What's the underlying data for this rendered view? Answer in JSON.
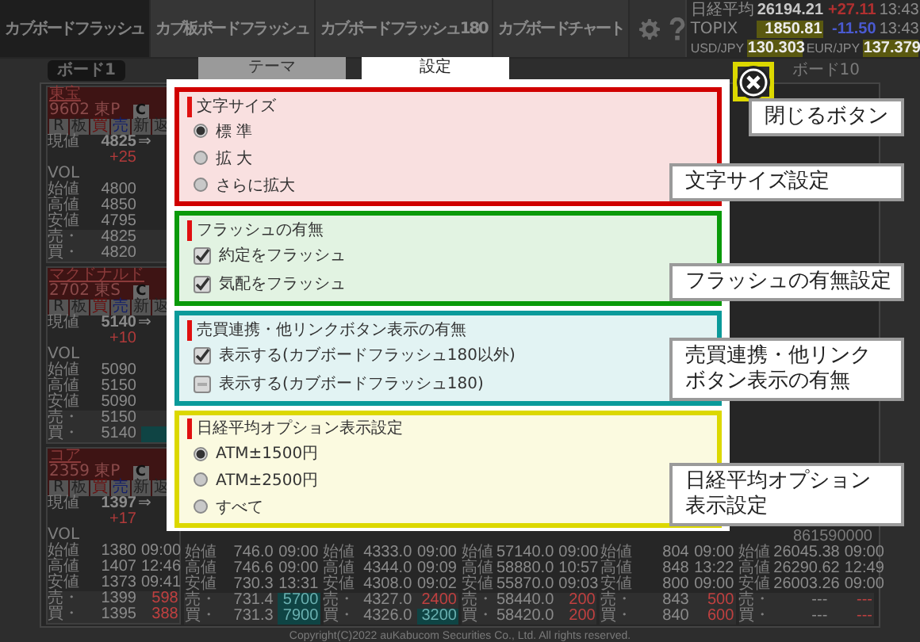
{
  "nav": {
    "tabs": [
      {
        "label": "カブボードフラッシュ",
        "selected": true
      },
      {
        "label": "カブ板ボードフラッシュ",
        "selected": false
      },
      {
        "label": "カブボードフラッシュ180",
        "selected": false
      },
      {
        "label": "カブボードチャート",
        "selected": false
      }
    ]
  },
  "indices": [
    {
      "name": "日経平均",
      "value": "26194.21",
      "highlight": false,
      "change": "+27.11",
      "color": "#b03030",
      "time": "13:43"
    },
    {
      "name": "TOPIX",
      "value": "1850.81",
      "highlight": true,
      "change": "-11.50",
      "color": "#4a5ad0",
      "time": "13:43"
    }
  ],
  "fx": [
    {
      "name": "USD/JPY",
      "value": "130.303",
      "highlight": true
    },
    {
      "name": "EUR/JPY",
      "value": "137.379",
      "highlight": true
    }
  ],
  "board_tabs": [
    {
      "label": "ボード1",
      "selected": true
    },
    {
      "label": "ボード10",
      "selected": false
    }
  ],
  "columns": [
    {
      "cards": [
        {
          "name": "東宝",
          "code": "9602 東P",
          "chip": "C",
          "buttons": [
            {
              "label": "R",
              "kind": "plain"
            },
            {
              "label": "板",
              "kind": "plain"
            },
            {
              "label": "買",
              "kind": "buy"
            },
            {
              "label": "売",
              "kind": "sell"
            },
            {
              "label": "新",
              "kind": "plain"
            },
            {
              "label": "返",
              "kind": "plain"
            }
          ],
          "price_label": "現値",
          "price": "4825",
          "arrow": "⇒",
          "change": "+25",
          "vol_label": "VOL",
          "rows": [
            {
              "label": "始値",
              "price": "4800",
              "kind": "time"
            },
            {
              "label": "高値",
              "price": "4850",
              "kind": "time"
            },
            {
              "label": "安値",
              "price": "4795",
              "kind": "time"
            },
            {
              "label": "売・",
              "price": "4825",
              "kind": "qty",
              "highlight": false
            },
            {
              "label": "買・",
              "price": "4820",
              "kind": "qty",
              "highlight": false
            }
          ]
        },
        {
          "name": "マクドナルド",
          "code": "2702 東S",
          "chip": "C",
          "buttons": [
            {
              "label": "R",
              "kind": "plain"
            },
            {
              "label": "板",
              "kind": "plain"
            },
            {
              "label": "買",
              "kind": "buy"
            },
            {
              "label": "売",
              "kind": "sell"
            },
            {
              "label": "新",
              "kind": "plain"
            },
            {
              "label": "返",
              "kind": "plain"
            }
          ],
          "price_label": "現値",
          "price": "5140",
          "arrow": "⇒",
          "change": "+10",
          "vol_label": "VOL",
          "rows": [
            {
              "label": "始値",
              "price": "5090",
              "kind": "time"
            },
            {
              "label": "高値",
              "price": "5150",
              "kind": "time"
            },
            {
              "label": "安値",
              "price": "5090",
              "kind": "time"
            },
            {
              "label": "売・",
              "price": "5150",
              "kind": "qty",
              "highlight": false
            },
            {
              "label": "買・",
              "price": "5140",
              "kind": "qty",
              "highlight": true
            }
          ]
        },
        {
          "name": "コア",
          "code": "2359 東P",
          "chip": "C",
          "buttons": [
            {
              "label": "R",
              "kind": "plain"
            },
            {
              "label": "板",
              "kind": "plain"
            },
            {
              "label": "買",
              "kind": "buy"
            },
            {
              "label": "売",
              "kind": "sell"
            },
            {
              "label": "新",
              "kind": "plain"
            },
            {
              "label": "返",
              "kind": "plain"
            }
          ],
          "price_label": "現値",
          "price": "1397",
          "arrow": "⇒",
          "change": "+17",
          "vol_label": "VOL",
          "rows": [
            {
              "label": "始値",
              "price": "1380",
              "extra": "09:00",
              "kind": "time"
            },
            {
              "label": "高値",
              "price": "1407",
              "extra": "12:46",
              "kind": "time"
            },
            {
              "label": "安値",
              "price": "1373",
              "extra": "09:41",
              "kind": "time"
            },
            {
              "label": "売・",
              "price": "1399",
              "extra": "598",
              "kind": "qty",
              "highlight": false
            },
            {
              "label": "買・",
              "price": "1395",
              "extra": "388",
              "kind": "qty",
              "highlight": false
            }
          ]
        }
      ]
    },
    {
      "tail": {
        "rows": [
          {
            "label": "始値",
            "price": "746.0",
            "extra": "09:00",
            "kind": "time"
          },
          {
            "label": "高値",
            "price": "746.6",
            "extra": "09:00",
            "kind": "time"
          },
          {
            "label": "安値",
            "price": "730.3",
            "extra": "13:31",
            "kind": "time"
          },
          {
            "label": "売・",
            "price": "731.4",
            "extra": "5700",
            "kind": "qty",
            "highlight": true
          },
          {
            "label": "買・",
            "price": "731.3",
            "extra": "7900",
            "kind": "qty",
            "highlight": true
          }
        ]
      }
    },
    {
      "tail": {
        "rows": [
          {
            "label": "始値",
            "price": "4333.0",
            "extra": "09:00",
            "kind": "time"
          },
          {
            "label": "高値",
            "price": "4344.0",
            "extra": "09:09",
            "kind": "time"
          },
          {
            "label": "安値",
            "price": "4308.0",
            "extra": "09:02",
            "kind": "time"
          },
          {
            "label": "売・",
            "price": "4327.0",
            "extra": "2400",
            "kind": "qty",
            "highlight": false
          },
          {
            "label": "買・",
            "price": "4326.0",
            "extra": "3200",
            "kind": "qty",
            "highlight": true
          }
        ]
      }
    },
    {
      "tail": {
        "rows": [
          {
            "label": "始値",
            "price": "57140.0",
            "extra": "09:00",
            "kind": "time"
          },
          {
            "label": "高値",
            "price": "58880.0",
            "extra": "10:57",
            "kind": "time"
          },
          {
            "label": "安値",
            "price": "55870.0",
            "extra": "09:03",
            "kind": "time"
          },
          {
            "label": "売・",
            "price": "58440.0",
            "extra": "200",
            "kind": "qty",
            "highlight": false
          },
          {
            "label": "買・",
            "price": "58420.0",
            "extra": "200",
            "kind": "qty",
            "highlight": false
          }
        ]
      }
    },
    {
      "tail": {
        "rows": [
          {
            "label": "始値",
            "price": "804",
            "extra": "09:00",
            "kind": "time"
          },
          {
            "label": "高値",
            "price": "848",
            "extra": "13:22",
            "kind": "time"
          },
          {
            "label": "安値",
            "price": "800",
            "extra": "09:00",
            "kind": "time"
          },
          {
            "label": "売・",
            "price": "843",
            "extra": "500",
            "kind": "qty",
            "highlight": false
          },
          {
            "label": "買・",
            "price": "840",
            "extra": "600",
            "kind": "qty",
            "highlight": false
          }
        ]
      }
    },
    {
      "tail": {
        "vol": "861590000",
        "rows": [
          {
            "label": "始値",
            "price": "26045.38",
            "extra": "09:00",
            "kind": "time"
          },
          {
            "label": "高値",
            "price": "26290.62",
            "extra": "12:49",
            "kind": "time"
          },
          {
            "label": "安値",
            "price": "26003.26",
            "extra": "09:00",
            "kind": "time"
          },
          {
            "label": "売・",
            "price": "---",
            "extra": "---",
            "kind": "qty",
            "highlight": false
          },
          {
            "label": "買・",
            "price": "---",
            "extra": "---",
            "kind": "qty",
            "highlight": false
          }
        ]
      }
    }
  ],
  "copyright": "Copyright(C)2022 auKabucom Securities Co., Ltd. All rights reserved.",
  "dialog": {
    "tabs": [
      {
        "label": "テーマ",
        "selected": false
      },
      {
        "label": "設定",
        "selected": true
      }
    ],
    "sections": [
      {
        "title": "文字サイズ",
        "kind": "radio",
        "color": "#d00000",
        "options": [
          {
            "label": "標 準",
            "selected": true
          },
          {
            "label": "拡 大",
            "selected": false
          },
          {
            "label": "さらに拡大",
            "selected": false
          }
        ]
      },
      {
        "title": "フラッシュの有無",
        "kind": "checkbox",
        "color": "#0a9a0a",
        "options": [
          {
            "label": "約定をフラッシュ",
            "checked": true
          },
          {
            "label": "気配をフラッシュ",
            "checked": true
          }
        ]
      },
      {
        "title": "売買連携・他リンクボタン表示の有無",
        "kind": "checkbox",
        "color": "#0a9a9a",
        "options": [
          {
            "label": "表示する(カブボードフラッシュ180以外)",
            "checked": true
          },
          {
            "label": "表示する(カブボードフラッシュ180)",
            "checked": false
          }
        ]
      },
      {
        "title": "日経平均オプション表示設定",
        "kind": "radio",
        "color": "#dcd800",
        "options": [
          {
            "label": "ATM±1500円",
            "selected": true
          },
          {
            "label": "ATM±2500円",
            "selected": false
          },
          {
            "label": "すべて",
            "selected": false
          }
        ]
      }
    ]
  },
  "callouts": [
    {
      "lines": [
        "閉じるボタン"
      ]
    },
    {
      "lines": [
        "文字サイズ設定"
      ]
    },
    {
      "lines": [
        "フラッシュの有無設定"
      ]
    },
    {
      "lines": [
        "売買連携・他リンク",
        "ボタン表示の有無"
      ]
    },
    {
      "lines": [
        "日経平均オプション",
        "表示設定"
      ]
    }
  ]
}
